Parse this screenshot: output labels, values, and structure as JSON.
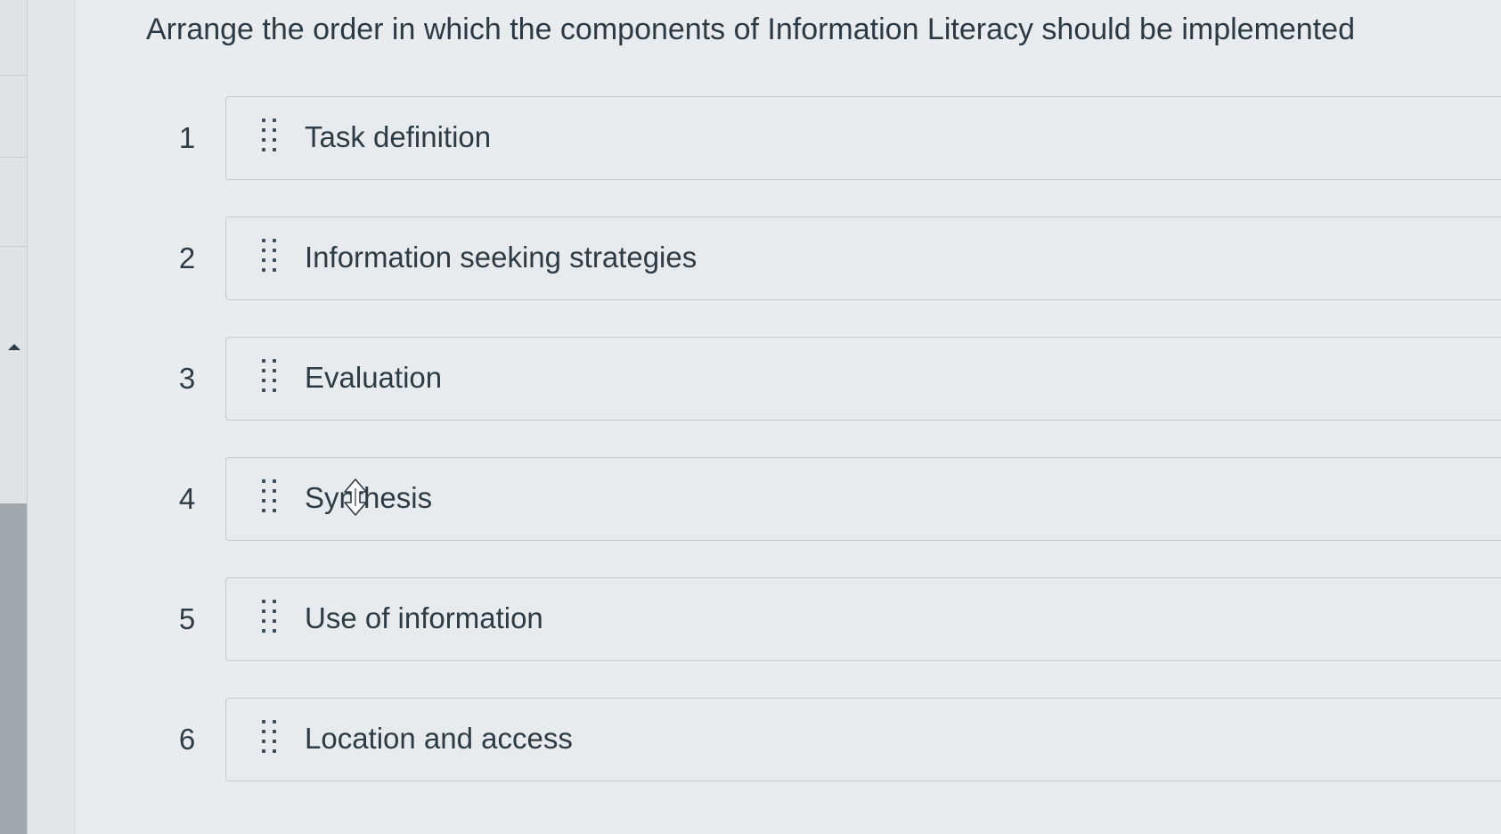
{
  "question": {
    "text": "Arrange the order in which the components of Information Literacy should be implemented"
  },
  "answers": [
    {
      "order": "1",
      "label": "Task definition"
    },
    {
      "order": "2",
      "label": "Information seeking strategies"
    },
    {
      "order": "3",
      "label": "Evaluation"
    },
    {
      "order": "4",
      "label": "Synthesis"
    },
    {
      "order": "5",
      "label": "Use of information"
    },
    {
      "order": "6",
      "label": "Location and access"
    }
  ],
  "icons": {
    "drag_handle": "drag-handle-icon",
    "cursor": "move-cursor-icon",
    "rail_arrow": "up-arrow-icon"
  }
}
